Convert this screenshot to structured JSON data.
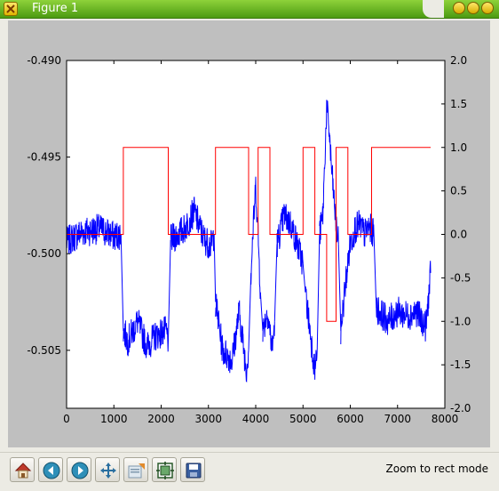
{
  "window": {
    "title": "Figure 1"
  },
  "toolbar": {
    "buttons": [
      {
        "icon": "home-icon"
      },
      {
        "icon": "back-arrow-icon"
      },
      {
        "icon": "forward-arrow-icon"
      },
      {
        "icon": "pan-icon"
      },
      {
        "icon": "zoom-rect-icon"
      },
      {
        "icon": "subplots-icon"
      },
      {
        "icon": "save-icon"
      }
    ],
    "status": "Zoom to rect mode"
  },
  "chart_data": {
    "type": "line",
    "title": "",
    "xlabel": "",
    "ylabel": "",
    "xlim": [
      0,
      8000
    ],
    "ylim_left": [
      -0.508,
      -0.49
    ],
    "ylim_right": [
      -2.0,
      2.0
    ],
    "x_ticks": [
      "0",
      "1000",
      "2000",
      "3000",
      "4000",
      "5000",
      "6000",
      "7000",
      "8000"
    ],
    "y_left_ticks": [
      "-0.490",
      "-0.495",
      "-0.500",
      "-0.505"
    ],
    "y_right_ticks": [
      "2.0",
      "1.5",
      "1.0",
      "0.5",
      "0.0",
      "-0.5",
      "-1.0",
      "-1.5",
      "-2.0"
    ],
    "colors": {
      "signal": "#0000ff",
      "state": "#ff0000"
    },
    "series": [
      {
        "axis": "left",
        "color": "#0000ff",
        "segments": [
          {
            "x": [
              0,
              300,
              700,
              1000,
              1150
            ],
            "y": [
              -0.4994,
              -0.4989,
              -0.4987,
              -0.4991,
              -0.499
            ]
          },
          {
            "x": [
              1200,
              1300,
              1500,
              1700,
              1900,
              2100,
              2150
            ],
            "y": [
              -0.504,
              -0.5045,
              -0.5035,
              -0.5048,
              -0.5042,
              -0.504,
              -0.5045
            ]
          },
          {
            "x": [
              2200,
              2500,
              2700,
              2900,
              3050,
              3120
            ],
            "y": [
              -0.4993,
              -0.4987,
              -0.4978,
              -0.4992,
              -0.4996,
              -0.499
            ]
          },
          {
            "x": [
              3150,
              3300,
              3500,
              3650,
              3800,
              3850
            ],
            "y": [
              -0.5025,
              -0.505,
              -0.5055,
              -0.503,
              -0.506,
              -0.505
            ]
          },
          {
            "x": [
              3900,
              3950,
              4000,
              4050,
              4100
            ],
            "y": [
              -0.501,
              -0.4985,
              -0.4965,
              -0.499,
              -0.502
            ]
          },
          {
            "x": [
              4150,
              4250,
              4350,
              4400
            ],
            "y": [
              -0.504,
              -0.503,
              -0.505,
              -0.5035
            ]
          },
          {
            "x": [
              4450,
              4600,
              4750,
              4900,
              5000
            ],
            "y": [
              -0.4995,
              -0.498,
              -0.4985,
              -0.4997,
              -0.5005
            ]
          },
          {
            "x": [
              5050,
              5150,
              5250,
              5300
            ],
            "y": [
              -0.502,
              -0.504,
              -0.506,
              -0.505
            ]
          },
          {
            "x": [
              5350,
              5420,
              5500,
              5550,
              5600,
              5700,
              5750
            ],
            "y": [
              -0.499,
              -0.498,
              -0.4925,
              -0.4935,
              -0.4955,
              -0.4985,
              -0.4995
            ]
          },
          {
            "x": [
              5800,
              5900,
              6000,
              6100,
              6200,
              6300,
              6400,
              6500
            ],
            "y": [
              -0.504,
              -0.5015,
              -0.4995,
              -0.4987,
              -0.4985,
              -0.499,
              -0.4986,
              -0.499
            ]
          },
          {
            "x": [
              6550,
              6800,
              7000,
              7200,
              7400,
              7600,
              7700
            ],
            "y": [
              -0.5028,
              -0.5035,
              -0.503,
              -0.5032,
              -0.503,
              -0.5038,
              -0.501
            ]
          }
        ]
      },
      {
        "axis": "right",
        "color": "#ff0000",
        "x": [
          0,
          1200,
          1200,
          2150,
          2150,
          3150,
          3150,
          3850,
          3850,
          4050,
          4050,
          4300,
          4300,
          5000,
          5000,
          5250,
          5250,
          5500,
          5500,
          5700,
          5700,
          5950,
          5950,
          6450,
          6450,
          7700
        ],
        "y": [
          0,
          0,
          1,
          1,
          0,
          0,
          1,
          1,
          0,
          0,
          1,
          1,
          0,
          0,
          1,
          1,
          0,
          0,
          -1,
          -1,
          1,
          1,
          0,
          0,
          1,
          1
        ]
      }
    ]
  }
}
